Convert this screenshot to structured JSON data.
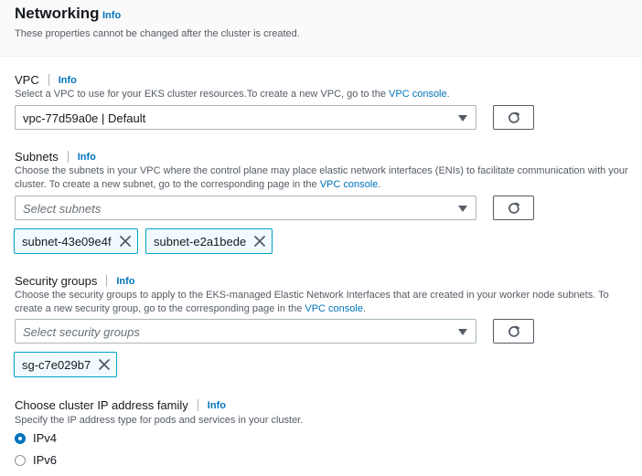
{
  "header": {
    "title": "Networking",
    "info": "Info",
    "description": "These properties cannot be changed after the cluster is created."
  },
  "vpc": {
    "label": "VPC",
    "info": "Info",
    "description_prefix": "Select a VPC to use for your EKS cluster resources.To create a new VPC, go to the ",
    "link": "VPC console",
    "description_suffix": ".",
    "selected_value": "vpc-77d59a0e | Default"
  },
  "subnets": {
    "label": "Subnets",
    "info": "Info",
    "description_prefix": "Choose the subnets in your VPC where the control plane may place elastic network interfaces (ENIs) to facilitate communication with your cluster. To create a new subnet, go to the corresponding page in the ",
    "link": "VPC console",
    "description_suffix": ".",
    "placeholder": "Select subnets",
    "tokens": [
      "subnet-43e09e4f",
      "subnet-e2a1bede"
    ]
  },
  "security_groups": {
    "label": "Security groups",
    "info": "Info",
    "description_prefix": "Choose the security groups to apply to the EKS-managed Elastic Network Interfaces that are created in your worker node subnets. To create a new security group, go to the corresponding page in the ",
    "link": "VPC console",
    "description_suffix": ".",
    "placeholder": "Select security groups",
    "tokens": [
      "sg-c7e029b7"
    ]
  },
  "ip_family": {
    "label": "Choose cluster IP address family",
    "info": "Info",
    "description": "Specify the IP address type for pods and services in your cluster.",
    "options": [
      "IPv4",
      "IPv6"
    ],
    "selected": "IPv4"
  },
  "colors": {
    "link": "#0073bb",
    "token_border": "#00a1c9",
    "token_bg": "#f1faff",
    "radio_selected": "#0073bb"
  },
  "icons": {
    "refresh": "refresh-icon",
    "dismiss": "close-icon",
    "dropdown": "caret-down-icon"
  }
}
